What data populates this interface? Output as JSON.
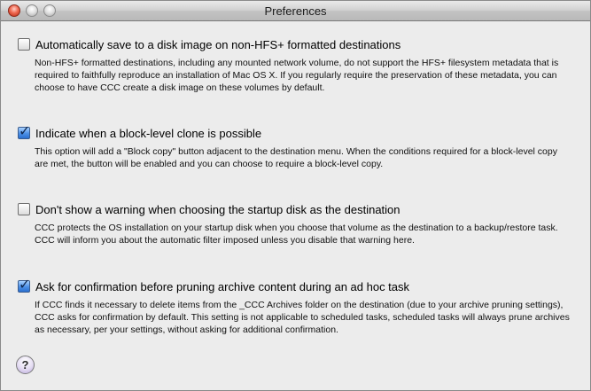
{
  "window": {
    "title": "Preferences"
  },
  "options": [
    {
      "label": "Automatically save to a disk image on non-HFS+ formatted destinations",
      "checked": false,
      "description": "Non-HFS+ formatted destinations, including any mounted network volume, do not support the HFS+ filesystem metadata that is required to faithfully reproduce an installation of Mac OS X. If you regularly require the preservation of these metadata, you can choose to have CCC create a disk image on these volumes by default."
    },
    {
      "label": "Indicate when a block-level clone is possible",
      "checked": true,
      "description": "This option will add a \"Block copy\" button adjacent to the destination menu. When the conditions required for a block-level copy are met, the button will be enabled and you can choose to require a block-level copy."
    },
    {
      "label": "Don't show a warning when choosing the startup disk as the destination",
      "checked": false,
      "description": "CCC protects the OS installation on your startup disk when you choose that volume as the destination to a backup/restore task. CCC will inform you about the automatic filter imposed unless you disable that warning here."
    },
    {
      "label": "Ask for confirmation before pruning archive content during an ad hoc task",
      "checked": true,
      "description": "If CCC finds it necessary to delete items from the _CCC Archives folder on the destination (due to your archive pruning settings), CCC asks for confirmation by default. This setting is not applicable to scheduled tasks, scheduled tasks will always prune archives as necessary, per your settings, without asking for additional confirmation."
    }
  ],
  "help": {
    "glyph": "?",
    "icon": "help-icon"
  },
  "colors": {
    "window_bg": "#ececec",
    "checkbox_checked": "#4b8fe6"
  }
}
